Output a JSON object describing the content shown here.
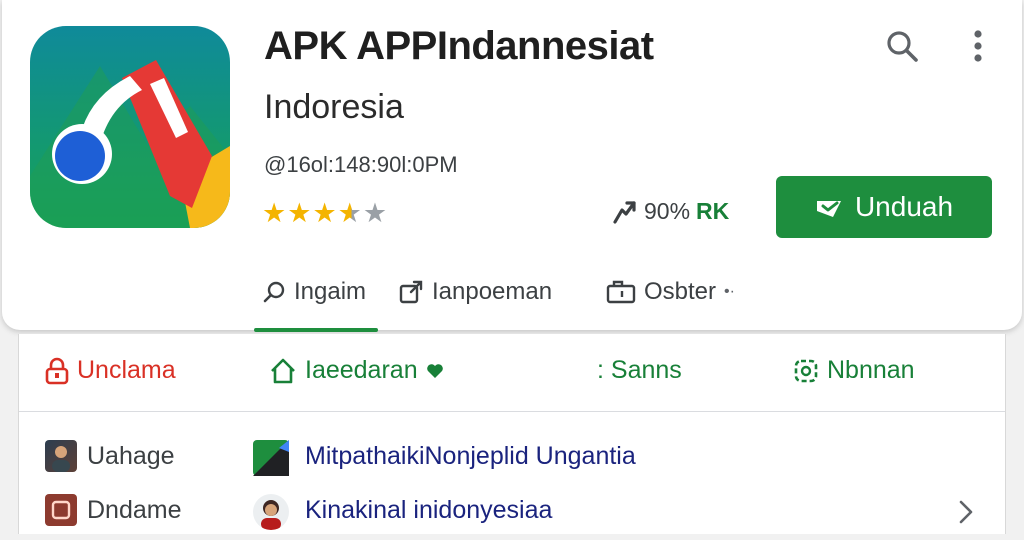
{
  "app": {
    "title": "APK APPIndannesiat",
    "subtitle": "Indoresia",
    "meta": "@16ol:148:90l:0PM",
    "rating": 3.5
  },
  "header": {
    "search_icon": "search-icon",
    "more_icon": "more-vert-icon"
  },
  "stats": {
    "percent": "90%",
    "suffix": "RK"
  },
  "install": {
    "label": "Unduah"
  },
  "tabs": [
    {
      "label": "Ingaim",
      "icon": "search-icon"
    },
    {
      "label": "Ianpoeman",
      "icon": "share-icon"
    },
    {
      "label": "Osbter",
      "icon": "folder-icon"
    }
  ],
  "categories": [
    {
      "label": "Unclama",
      "icon": "lock-icon"
    },
    {
      "label": "Iaeedaran",
      "icon": "home-icon"
    },
    {
      "label": ": Sanns",
      "icon": ""
    },
    {
      "label": "Nbnnan",
      "icon": "settings-icon"
    }
  ],
  "rows": [
    {
      "label": "Uahage",
      "value": "MitpathaikiNonjeplid Ungantia"
    },
    {
      "label": "Dndame",
      "value": "Kinakinal inidonyesiaa"
    }
  ],
  "colors": {
    "primary_green": "#1e8e3e",
    "alert_red": "#d93025",
    "star": "#f4b400"
  }
}
